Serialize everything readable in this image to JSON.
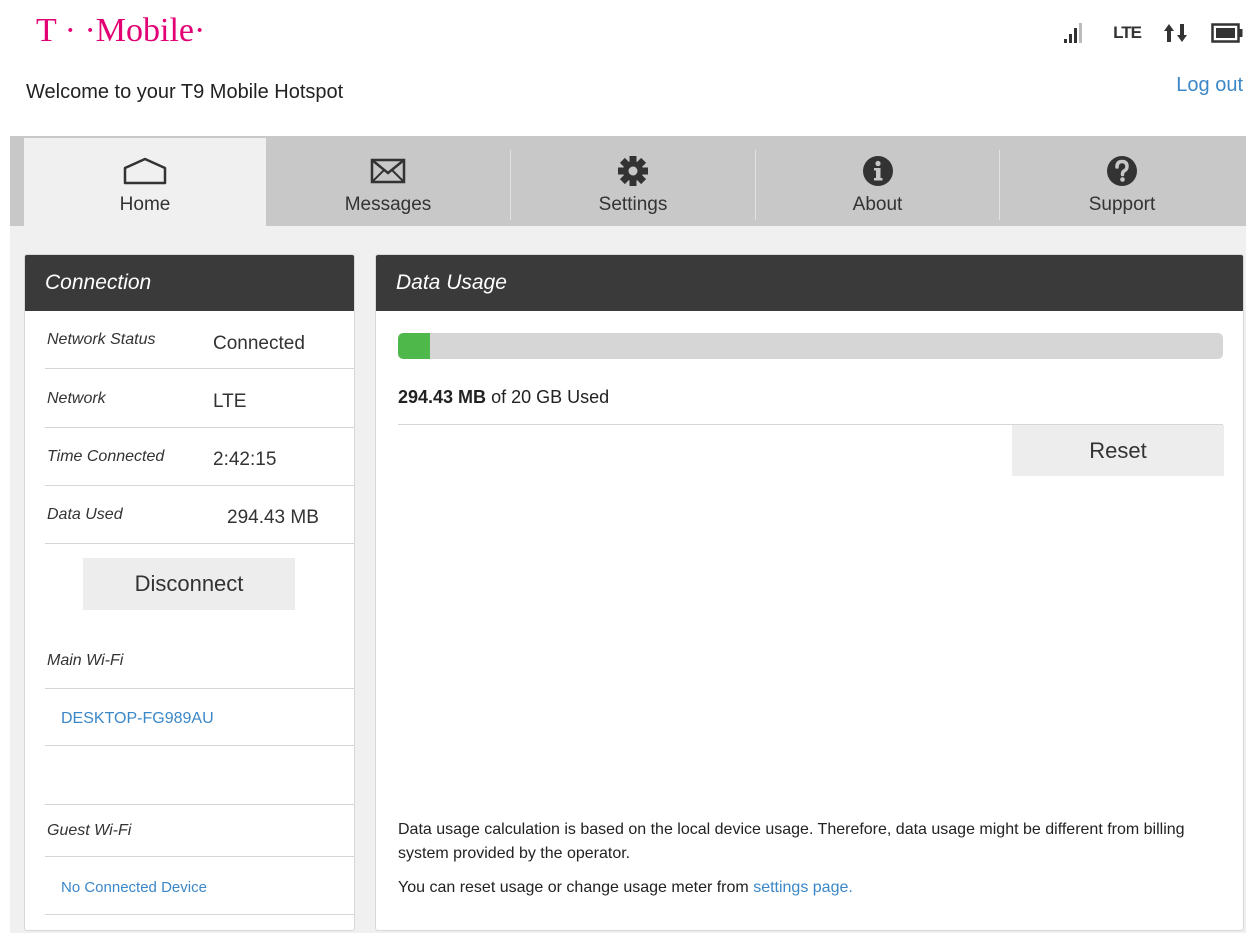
{
  "brand": {
    "logo_text": "T · ·Mobile·",
    "accent_color": "#e20074"
  },
  "status_bar": {
    "signal_icon": "signal-bars-icon",
    "network_type": "LTE",
    "data_icon": "up-down-arrows-icon",
    "battery_icon": "battery-icon"
  },
  "header": {
    "welcome": "Welcome to your T9 Mobile Hotspot",
    "logout": "Log out"
  },
  "tabs": [
    {
      "label": "Home",
      "icon": "home-icon",
      "active": true
    },
    {
      "label": "Messages",
      "icon": "envelope-icon",
      "active": false
    },
    {
      "label": "Settings",
      "icon": "gear-icon",
      "active": false
    },
    {
      "label": "About",
      "icon": "info-icon",
      "active": false
    },
    {
      "label": "Support",
      "icon": "question-icon",
      "active": false
    }
  ],
  "connection": {
    "title": "Connection",
    "rows": [
      {
        "label": "Network Status",
        "value": "Connected"
      },
      {
        "label": "Network",
        "value": "LTE"
      },
      {
        "label": "Time Connected",
        "value": "2:42:15"
      },
      {
        "label": "Data Used",
        "value": "294.43 MB"
      }
    ],
    "disconnect": "Disconnect",
    "main_wifi": {
      "label": "Main Wi-Fi",
      "devices": [
        "DESKTOP-FG989AU"
      ]
    },
    "guest_wifi": {
      "label": "Guest Wi-Fi",
      "devices": [
        "No Connected Device"
      ]
    }
  },
  "data_usage": {
    "title": "Data Usage",
    "used": "294.43 MB",
    "of_text": " of 20 GB Used",
    "fraction_used": 0.0147,
    "bar_color": "#4fb84a",
    "reset": "Reset",
    "note": "Data usage calculation is based on the local device usage. Therefore, data usage might be different from billing system provided by the operator.",
    "note2_prefix": "You can reset usage or change usage meter from ",
    "note2_link": "settings page."
  }
}
